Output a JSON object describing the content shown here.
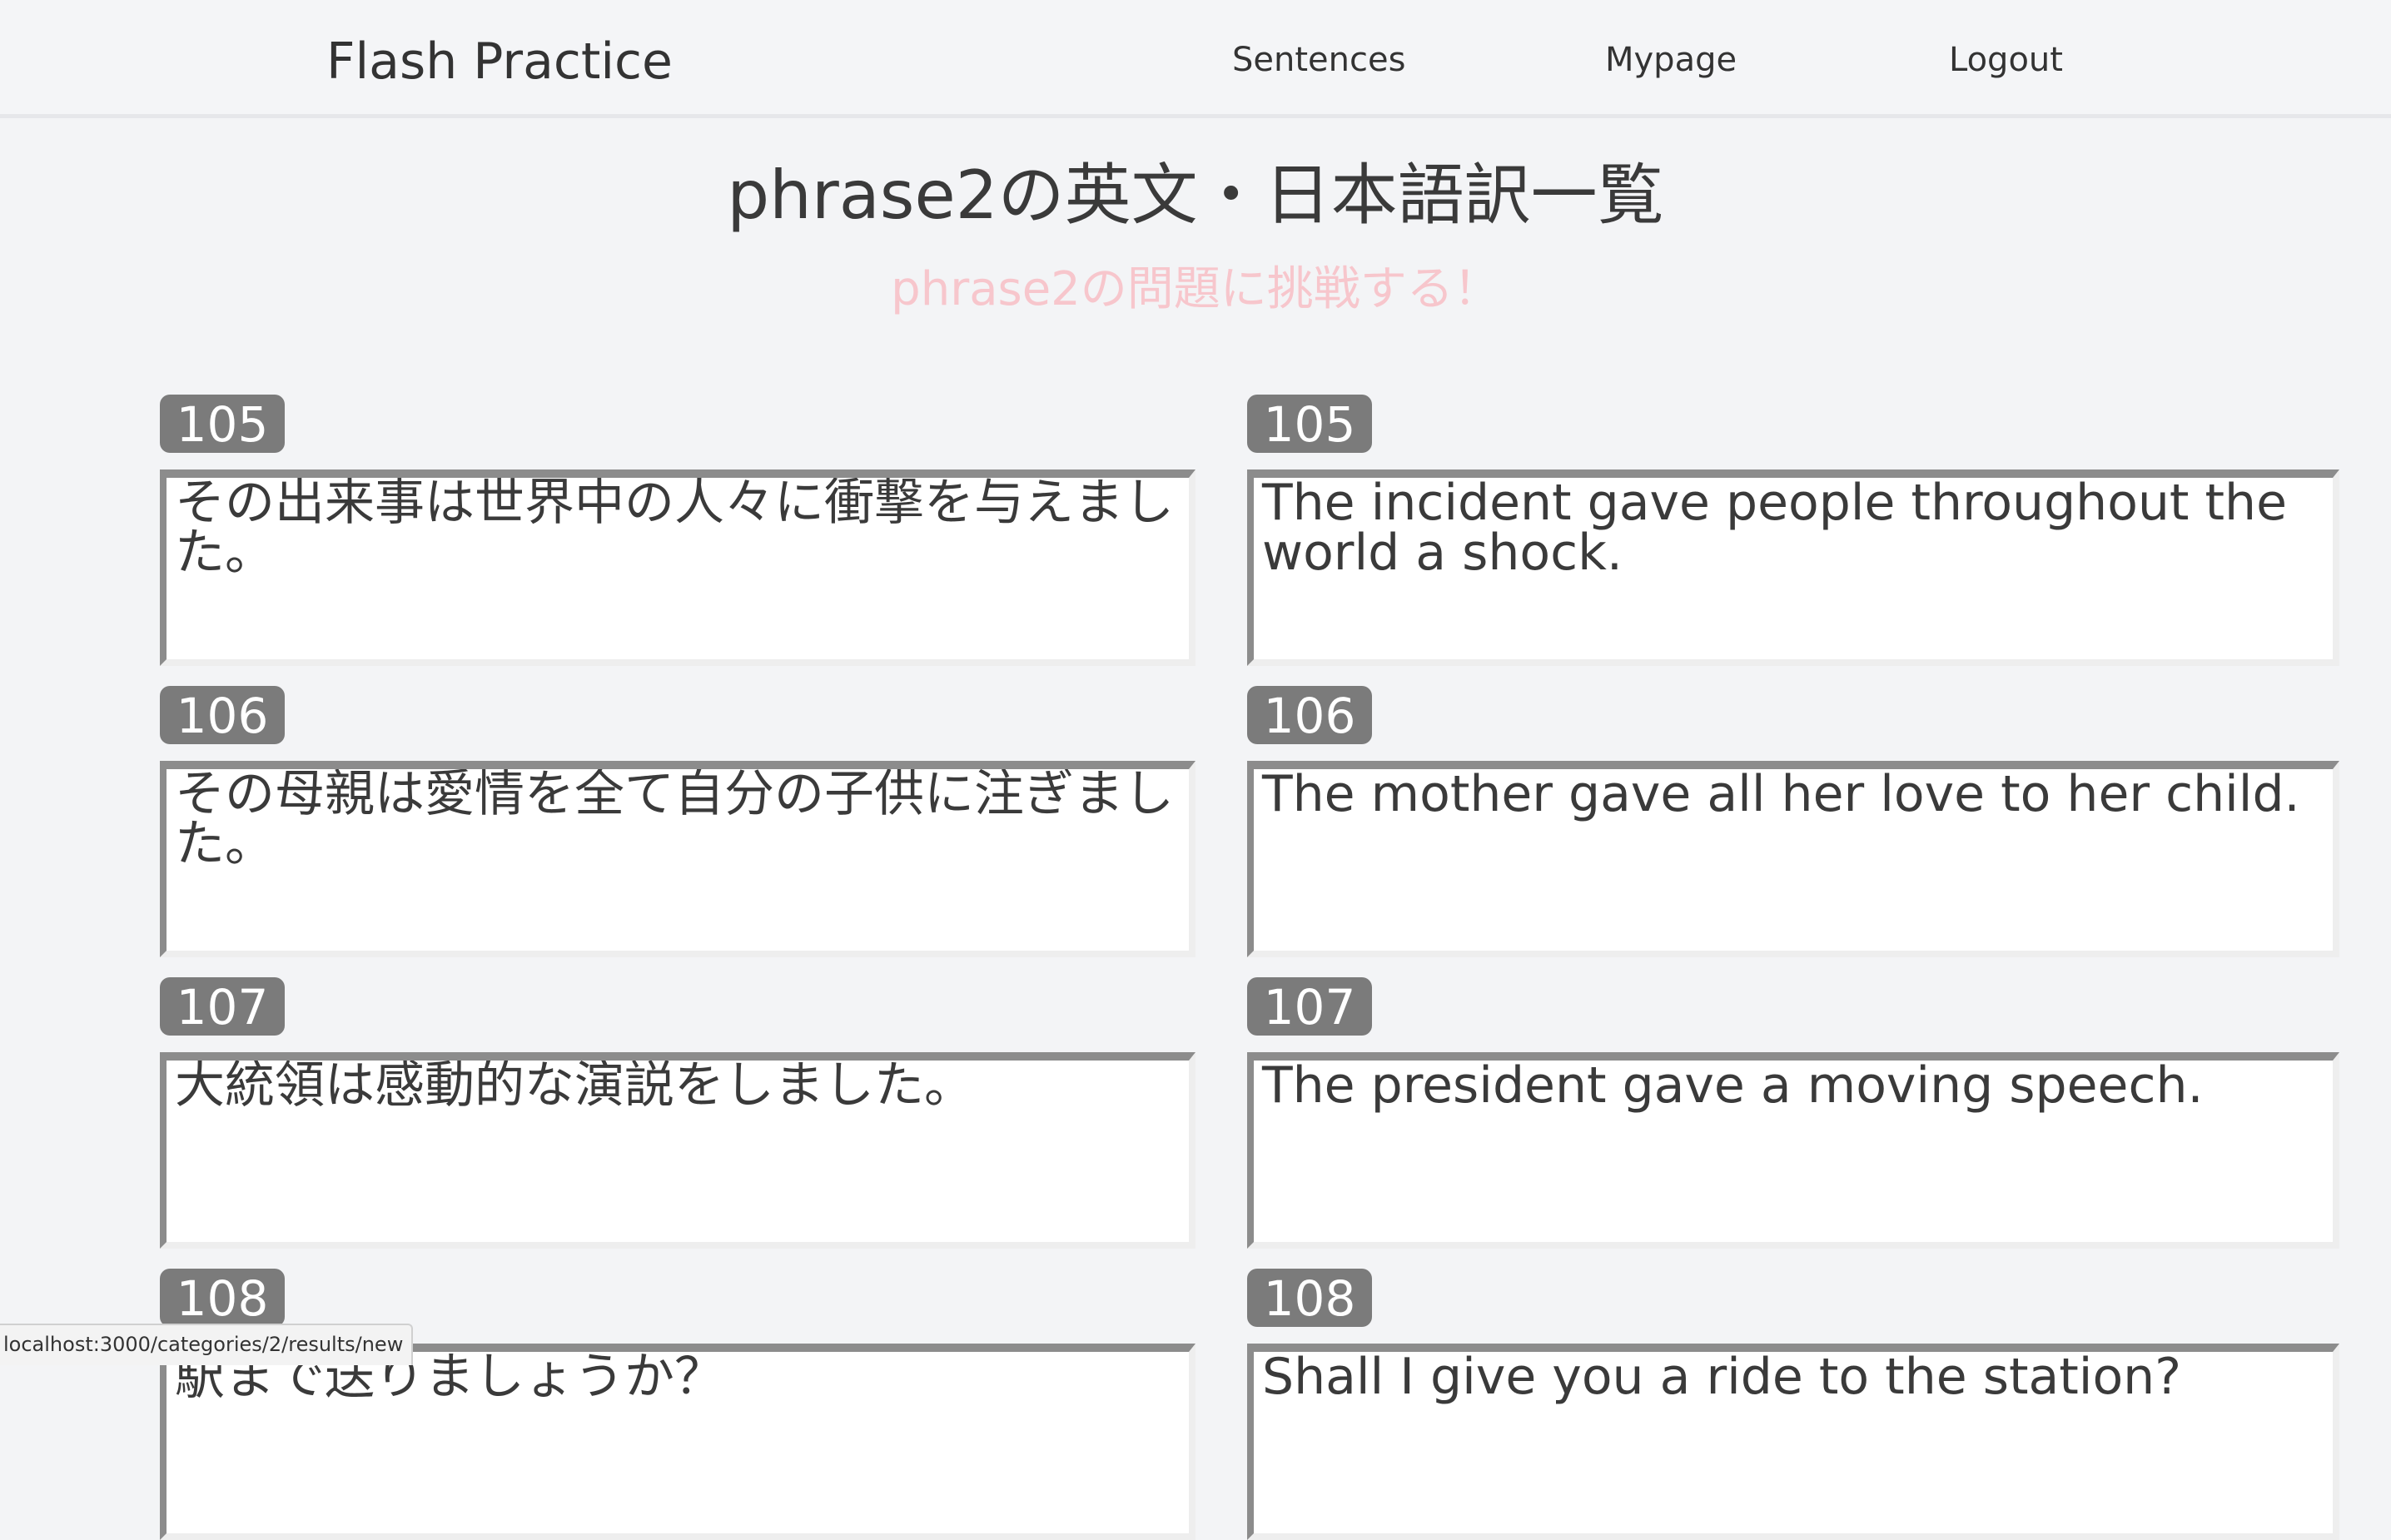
{
  "nav": {
    "brand": "Flash Practice",
    "links": [
      "Sentences",
      "Mypage",
      "Logout"
    ]
  },
  "page": {
    "title": "phrase2の英文・日本語訳一覧",
    "challenge": "phrase2の問題に挑戦する！"
  },
  "rows": [
    {
      "number": "105",
      "japanese": "その出来事は世界中の人々に衝撃を与えました。",
      "english": "The incident gave people throughout the world a shock."
    },
    {
      "number": "106",
      "japanese": "その母親は愛情を全て自分の子供に注ぎました。",
      "english": "The mother gave all her love to her child."
    },
    {
      "number": "107",
      "japanese": "大統領は感動的な演説をしました。",
      "english": "The president gave a moving speech."
    },
    {
      "number": "108",
      "japanese": "駅まで送りましょうか？",
      "english": "Shall I give you a ride to the station?"
    }
  ],
  "status_bar": {
    "url": "localhost:3000/categories/2/results/new"
  }
}
